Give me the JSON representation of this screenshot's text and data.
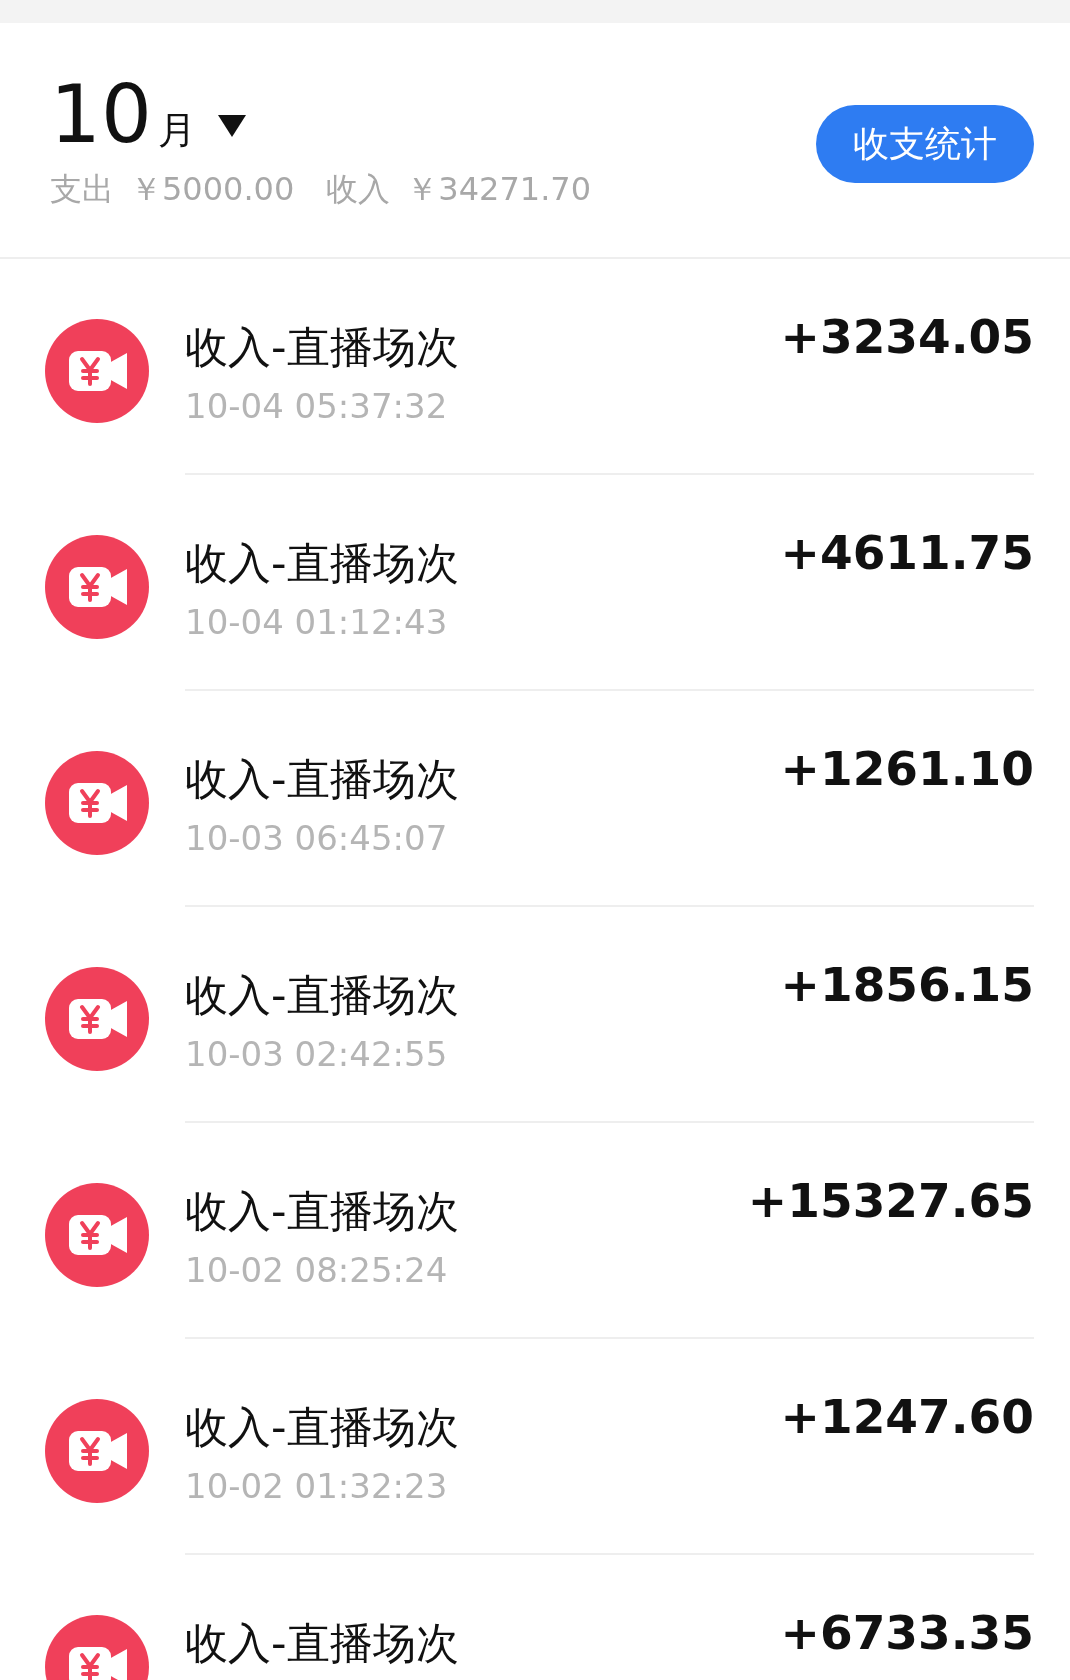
{
  "header": {
    "month": "10",
    "month_unit": "月",
    "summary": [
      {
        "label": "支出",
        "amount": "￥5000.00"
      },
      {
        "label": "收入",
        "amount": "￥34271.70"
      }
    ],
    "stats_button": "收支统计"
  },
  "transactions": [
    {
      "title": "收入-直播场次",
      "time": "10-04 05:37:32",
      "amount": "+3234.05"
    },
    {
      "title": "收入-直播场次",
      "time": "10-04 01:12:43",
      "amount": "+4611.75"
    },
    {
      "title": "收入-直播场次",
      "time": "10-03 06:45:07",
      "amount": "+1261.10"
    },
    {
      "title": "收入-直播场次",
      "time": "10-03 02:42:55",
      "amount": "+1856.15"
    },
    {
      "title": "收入-直播场次",
      "time": "10-02 08:25:24",
      "amount": "+15327.65"
    },
    {
      "title": "收入-直播场次",
      "time": "10-02 01:32:23",
      "amount": "+1247.60"
    },
    {
      "title": "收入-直播场次",
      "amount": "+6733.35"
    }
  ]
}
